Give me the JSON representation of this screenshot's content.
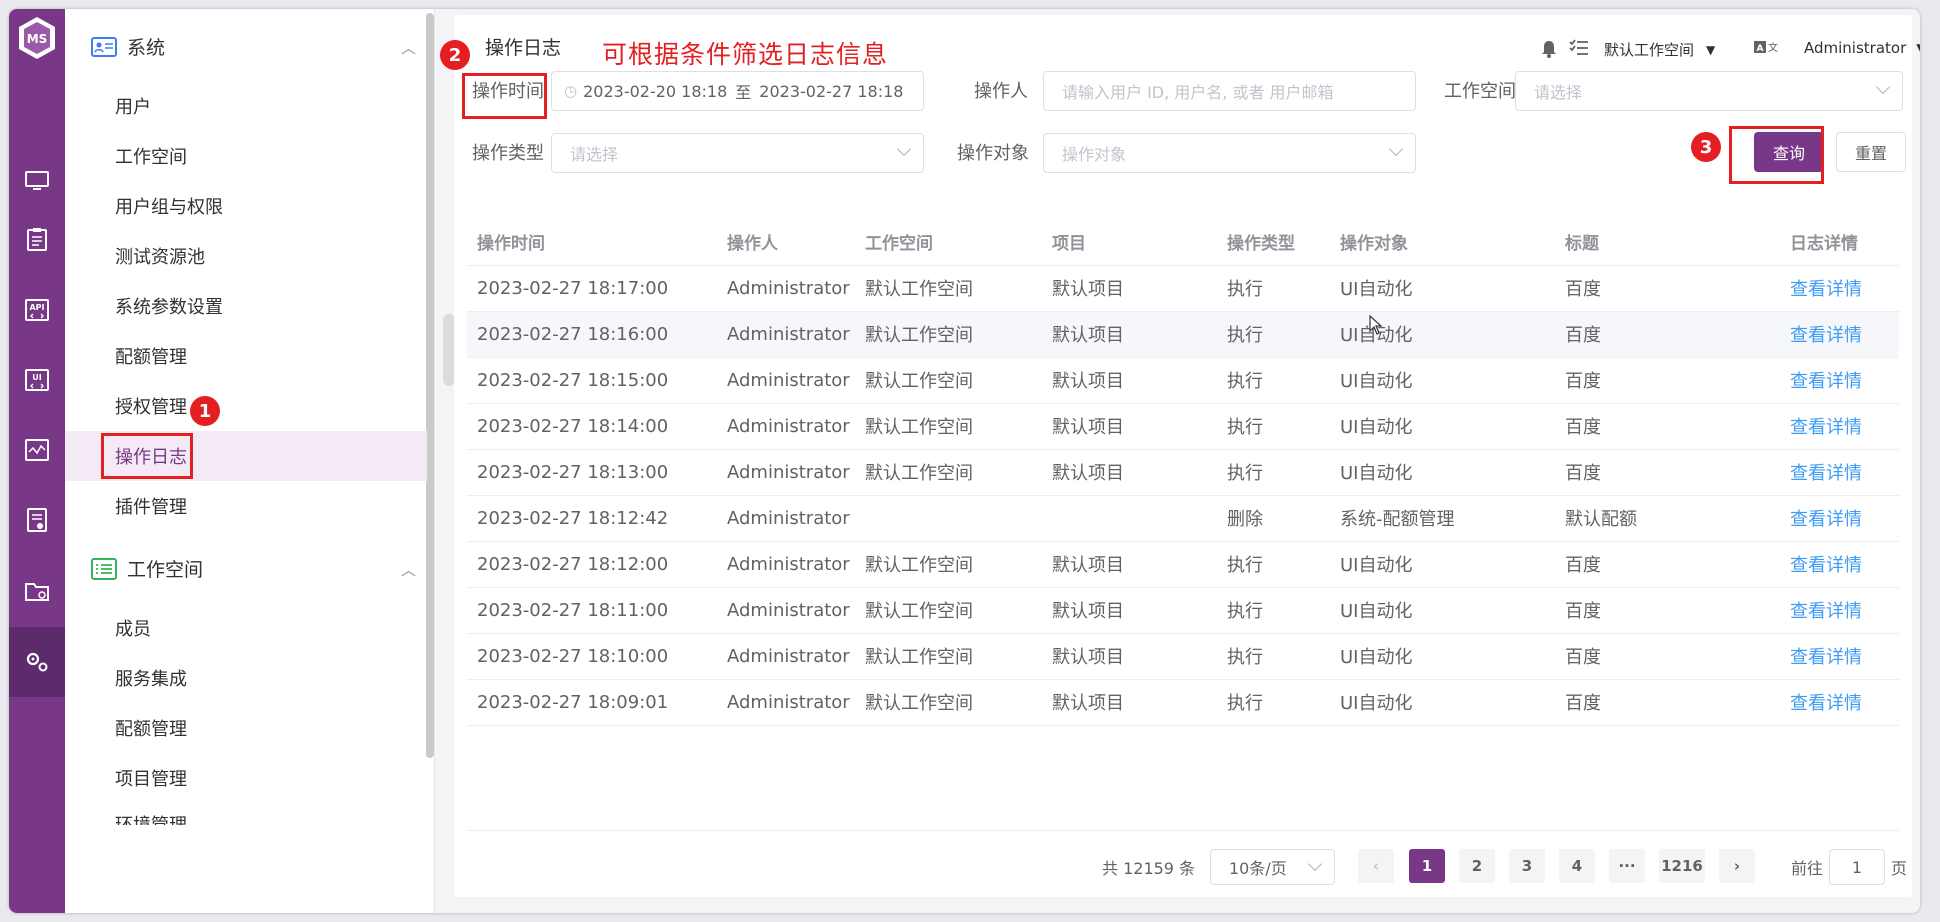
{
  "rail": {
    "logo_text": "MS",
    "icons": [
      "monitor-icon",
      "clipboard-icon",
      "api-icon",
      "ui-icon",
      "performance-icon",
      "report-icon",
      "folder-icon",
      "settings-icon"
    ]
  },
  "sidebar": {
    "system_group": "系统",
    "system_items": [
      "用户",
      "工作空间",
      "用户组与权限",
      "测试资源池",
      "系统参数设置",
      "配额管理",
      "授权管理",
      "操作日志",
      "插件管理"
    ],
    "workspace_group": "工作空间",
    "workspace_items": [
      "成员",
      "服务集成",
      "配额管理",
      "项目管理",
      "环境管理"
    ]
  },
  "header": {
    "title": "操作日志",
    "hint": "可根据条件筛选日志信息",
    "workspace": "默认工作空间",
    "user": "Administrator"
  },
  "markers": [
    "1",
    "2",
    "3"
  ],
  "filters": {
    "time_label": "操作时间",
    "time_start": "2023-02-20 18:18",
    "time_sep": "至",
    "time_end": "2023-02-27 18:18",
    "operator_label": "操作人",
    "operator_placeholder": "请输入用户 ID, 用户名, 或者 用户邮箱",
    "workspace_label": "工作空间",
    "workspace_placeholder": "请选择",
    "type_label": "操作类型",
    "type_placeholder": "请选择",
    "object_label": "操作对象",
    "object_placeholder": "操作对象",
    "query_button": "查询",
    "reset_button": "重置"
  },
  "table": {
    "headers": [
      "操作时间",
      "操作人",
      "工作空间",
      "项目",
      "操作类型",
      "操作对象",
      "标题",
      "日志详情"
    ],
    "rows": [
      [
        "2023-02-27 18:17:00",
        "Administrator",
        "默认工作空间",
        "默认项目",
        "执行",
        "UI自动化",
        "百度",
        "查看详情"
      ],
      [
        "2023-02-27 18:16:00",
        "Administrator",
        "默认工作空间",
        "默认项目",
        "执行",
        "UI自动化",
        "百度",
        "查看详情"
      ],
      [
        "2023-02-27 18:15:00",
        "Administrator",
        "默认工作空间",
        "默认项目",
        "执行",
        "UI自动化",
        "百度",
        "查看详情"
      ],
      [
        "2023-02-27 18:14:00",
        "Administrator",
        "默认工作空间",
        "默认项目",
        "执行",
        "UI自动化",
        "百度",
        "查看详情"
      ],
      [
        "2023-02-27 18:13:00",
        "Administrator",
        "默认工作空间",
        "默认项目",
        "执行",
        "UI自动化",
        "百度",
        "查看详情"
      ],
      [
        "2023-02-27 18:12:42",
        "Administrator",
        "",
        "",
        "删除",
        "系统-配额管理",
        "默认配额",
        "查看详情"
      ],
      [
        "2023-02-27 18:12:00",
        "Administrator",
        "默认工作空间",
        "默认项目",
        "执行",
        "UI自动化",
        "百度",
        "查看详情"
      ],
      [
        "2023-02-27 18:11:00",
        "Administrator",
        "默认工作空间",
        "默认项目",
        "执行",
        "UI自动化",
        "百度",
        "查看详情"
      ],
      [
        "2023-02-27 18:10:00",
        "Administrator",
        "默认工作空间",
        "默认项目",
        "执行",
        "UI自动化",
        "百度",
        "查看详情"
      ],
      [
        "2023-02-27 18:09:01",
        "Administrator",
        "默认工作空间",
        "默认项目",
        "执行",
        "UI自动化",
        "百度",
        "查看详情"
      ]
    ]
  },
  "pagination": {
    "total": "共 12159 条",
    "page_size": "10条/页",
    "pages": [
      "1",
      "2",
      "3",
      "4",
      "···",
      "1216"
    ],
    "goto_prefix": "前往",
    "goto_value": "1",
    "goto_suffix": "页"
  },
  "colors": {
    "brand": "#783887",
    "marker": "#e41f22",
    "link": "#3e9cf5"
  }
}
